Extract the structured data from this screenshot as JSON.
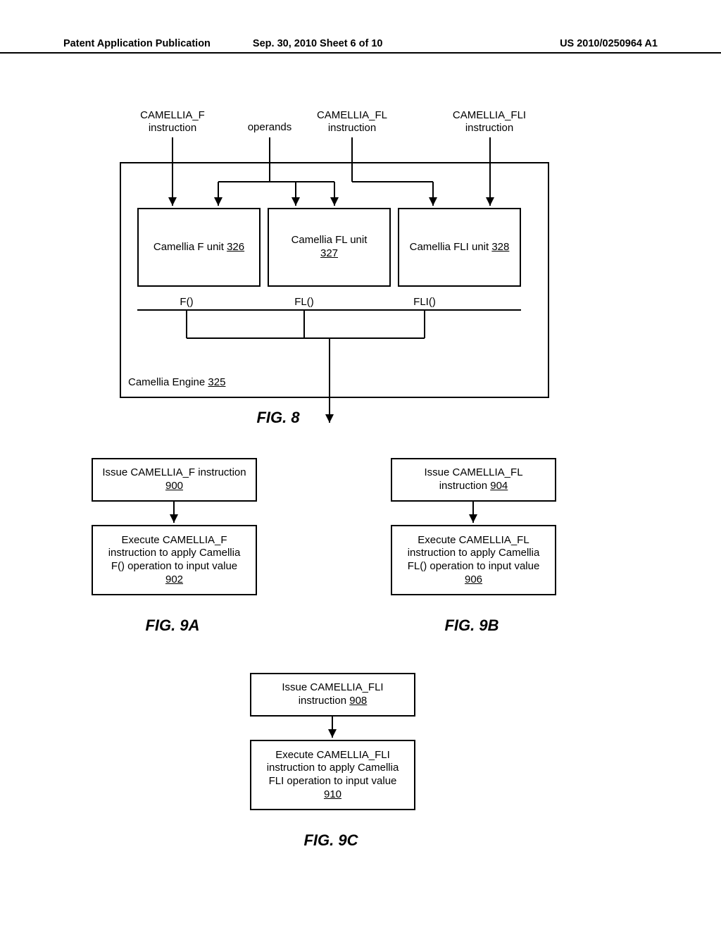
{
  "header": {
    "left": "Patent Application Publication",
    "mid": "Sep. 30, 2010  Sheet 6 of 10",
    "right": "US 2010/0250964 A1"
  },
  "toplabels": {
    "f": {
      "l1": "CAMELLIA_F",
      "l2": "instruction"
    },
    "operands": "operands",
    "fl": {
      "l1": "CAMELLIA_FL",
      "l2": "instruction"
    },
    "fli": {
      "l1": "CAMELLIA_FLI",
      "l2": "instruction"
    }
  },
  "units": {
    "f": {
      "name": "Camellia F unit ",
      "ref": "326"
    },
    "fl": {
      "name": "Camellia FL unit",
      "ref": "327"
    },
    "fli": {
      "name": "Camellia FLI unit ",
      "ref": "328"
    }
  },
  "outputs": {
    "f": "F()",
    "fl": "FL()",
    "fli": "FLI()"
  },
  "engine": {
    "name": "Camellia Engine ",
    "ref": "325"
  },
  "fig8": "FIG. 8",
  "flow9a": {
    "issue": {
      "t": "Issue CAMELLIA_F instruction",
      "ref": "900"
    },
    "exec": {
      "l1": "Execute CAMELLIA_F",
      "l2": "instruction to apply Camellia",
      "l3": "F() operation to input value",
      "ref": "902"
    },
    "fig": "FIG. 9A"
  },
  "flow9b": {
    "issue": {
      "t": "Issue CAMELLIA_FL",
      "ref": "904"
    },
    "issue2": "instruction ",
    "exec": {
      "l1": "Execute CAMELLIA_FL",
      "l2": "instruction to apply Camellia",
      "l3": "FL() operation to input value",
      "ref": "906"
    },
    "fig": "FIG. 9B"
  },
  "flow9c": {
    "issue": {
      "t": "Issue CAMELLIA_FLI",
      "ref": "908"
    },
    "issue2": "instruction ",
    "exec": {
      "l1": "Execute CAMELLIA_FLI",
      "l2": "instruction to apply Camellia",
      "l3": "FLI operation to input value",
      "ref": "910"
    },
    "fig": "FIG. 9C"
  }
}
